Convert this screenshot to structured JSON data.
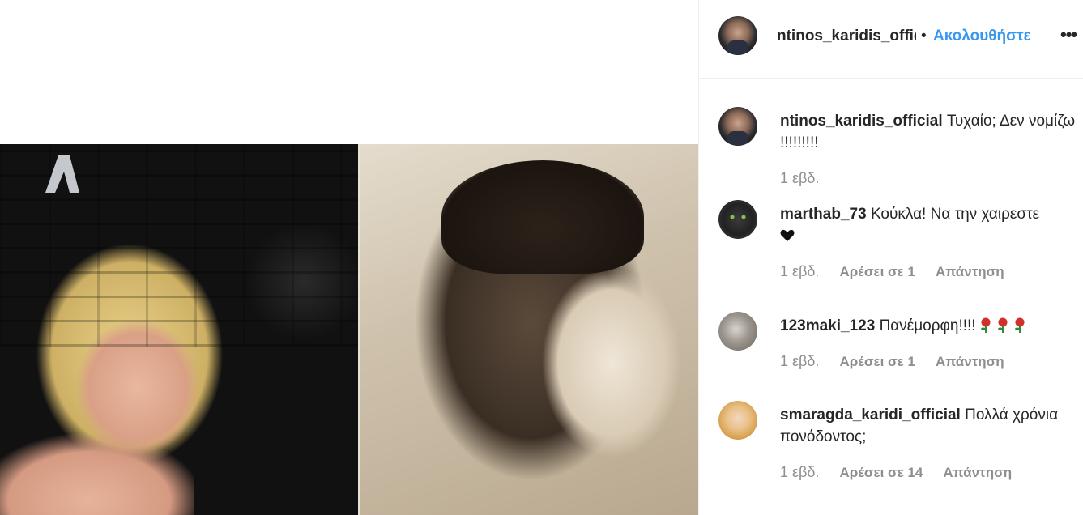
{
  "post": {
    "username": "ntinos_karidis_offic",
    "separator": "•",
    "follow_label": "Ακολουθήστε",
    "more_icon": "more-options-icon",
    "channel_logo": "Α"
  },
  "comments": [
    {
      "username": "ntinos_karidis_official",
      "text": "Τυχαίο; Δεν νομίζω !!!!!!!!!",
      "time": "1 εβδ.",
      "avatar": "dimitris"
    },
    {
      "username": "marthab_73",
      "text": "Κούκλα! Να την χαιρεστε",
      "emoji": "heart-icon",
      "time": "1 εβδ.",
      "likes": "Αρέσει σε 1",
      "reply": "Απάντηση",
      "avatar": "cat"
    },
    {
      "username": "123maki_123",
      "text": "Πανέμορφη!!!!",
      "emoji": "rose-icon",
      "time": "1 εβδ.",
      "likes": "Αρέσει σε 1",
      "reply": "Απάντηση",
      "avatar": "maki"
    },
    {
      "username": "smaragda_karidi_official",
      "text": "Πολλά χρόνια πονόδοντος;",
      "time": "1 εβδ.",
      "likes": "Αρέσει σε 14",
      "reply": "Απάντηση",
      "avatar": "smaragda"
    }
  ],
  "colors": {
    "link_blue": "#3897f0",
    "meta_gray": "#8e8e8e",
    "text": "#262626"
  }
}
